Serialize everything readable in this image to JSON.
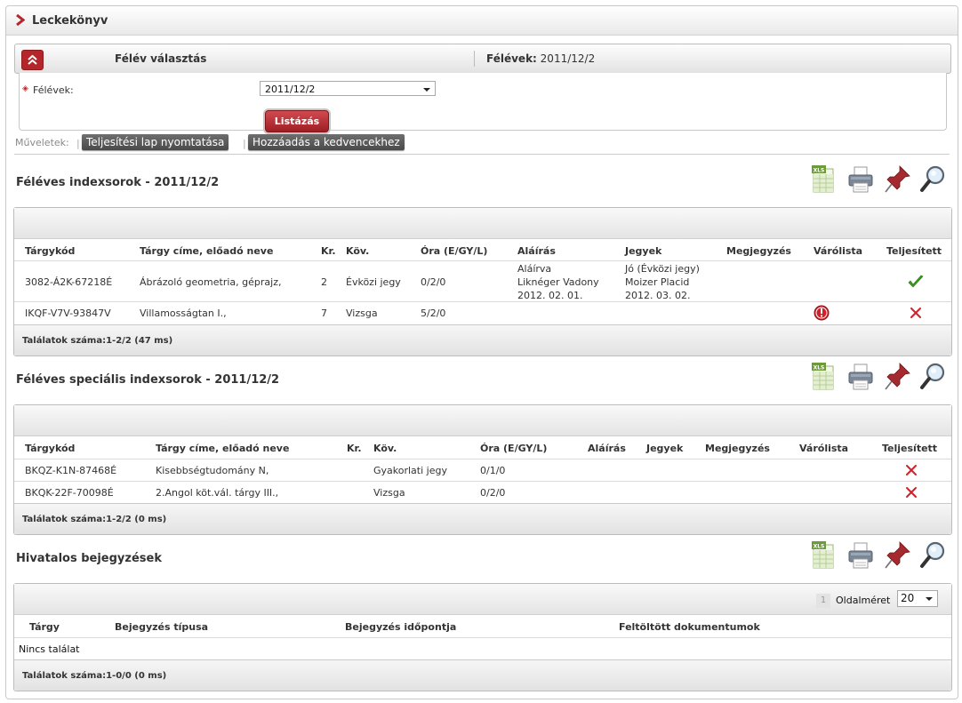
{
  "title": "Leckekönyv",
  "felev_bar": {
    "label": "Félév választás",
    "current_label": "Félévek:",
    "current_value": "2011/12/2"
  },
  "felev_form": {
    "field_label": "Félévek:",
    "select_value": "2011/12/2",
    "submit_label": "Listázás"
  },
  "operations": {
    "label": "Műveletek:",
    "print_label": "Teljesítési lap nyomtatása",
    "favorite_label": "Hozzáadás a kedvencekhez"
  },
  "toolbar_icons": [
    "xls-export-icon",
    "print-icon",
    "pin-icon",
    "search-icon"
  ],
  "section1": {
    "title": "Féléves indexsorok - 2011/12/2",
    "headers": [
      "Tárgykód",
      "Tárgy címe, előadó neve",
      "Kr.",
      "Köv.",
      "Óra (E/GY/L)",
      "Aláírás",
      "Jegyek",
      "Megjegyzés",
      "Várólista",
      "Teljesített"
    ],
    "rows": [
      {
        "code": "3082-Á2K-67218É",
        "name": "Ábrázoló geometria, géprajz,",
        "credit": "2",
        "req": "Évközi jegy",
        "hours": "0/2/0",
        "signature": [
          "Aláírva",
          "Liknéger Vadony",
          "2012. 02. 01."
        ],
        "grades": [
          "Jó (Évközi jegy)",
          "Moizer Placid",
          "2012. 03. 02."
        ],
        "done": "check"
      },
      {
        "code": "IKQF-V7V-93847V",
        "name": "Villamosságtan I.,",
        "credit": "7",
        "req": "Vizsga",
        "hours": "5/2/0",
        "waitlist": "warning",
        "done": "cross"
      }
    ],
    "footer": "Találatok száma:1-2/2 (47 ms)"
  },
  "section2": {
    "title": "Féléves speciális indexsorok - 2011/12/2",
    "headers": [
      "Tárgykód",
      "Tárgy címe, előadó neve",
      "Kr.",
      "Köv.",
      "Óra (E/GY/L)",
      "Aláírás",
      "Jegyek",
      "Megjegyzés",
      "Várólista",
      "Teljesített"
    ],
    "rows": [
      {
        "code": "BKQZ-K1N-87468É",
        "name": "Kisebbségtudomány N,",
        "req": "Gyakorlati jegy",
        "hours": "0/1/0",
        "done": "cross"
      },
      {
        "code": "BKQK-22F-70098É",
        "name": "2.Angol köt.vál. tárgy III.,",
        "req": "Vizsga",
        "hours": "0/2/0",
        "done": "cross"
      }
    ],
    "footer": "Találatok száma:1-2/2 (0 ms)"
  },
  "section3": {
    "title": "Hivatalos bejegyzések",
    "pager": {
      "page": "1",
      "size_label": "Oldalméret",
      "size_value": "20"
    },
    "headers": [
      "Tárgy",
      "Bejegyzés típusa",
      "Bejegyzés időpontja",
      "Feltöltött dokumentumok"
    ],
    "empty_text": "Nincs találat",
    "footer": "Találatok száma:1-0/0 (0 ms)"
  },
  "colors": {
    "accent_red": "#b5262b",
    "success_green": "#3c9a1e",
    "error_red": "#d0202a"
  }
}
